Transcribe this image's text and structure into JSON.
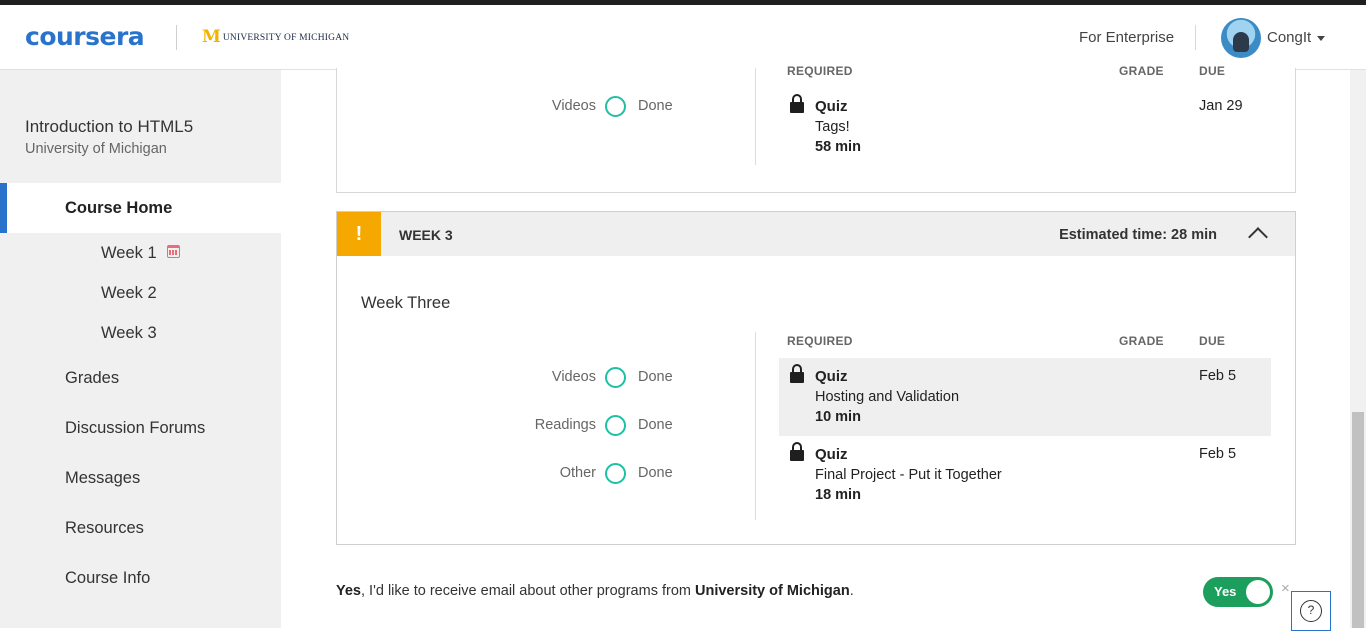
{
  "header": {
    "logo": "coursera",
    "partner": {
      "mark": "M",
      "name": "UNIVERSITY OF MICHIGAN"
    },
    "enterprise_link": "For Enterprise",
    "user_name": "CongIt"
  },
  "sidebar": {
    "course_title": "Introduction to HTML5",
    "course_org": "University of Michigan",
    "items": [
      {
        "label": "Course Home",
        "active": true
      },
      {
        "label": "Week 1",
        "sub": true
      },
      {
        "label": "Week 2",
        "sub": true
      },
      {
        "label": "Week 3",
        "sub": true
      },
      {
        "label": "Grades"
      },
      {
        "label": "Discussion Forums"
      },
      {
        "label": "Messages"
      },
      {
        "label": "Resources"
      },
      {
        "label": "Course Info"
      }
    ]
  },
  "week_prev": {
    "progress": [
      {
        "label": "Videos",
        "status": "Done"
      }
    ],
    "columns": {
      "required": "REQUIRED",
      "grade": "GRADE",
      "due": "DUE"
    },
    "items": [
      {
        "type": "Quiz",
        "name": "Tags!",
        "time": "58 min",
        "due": "Jan 29"
      }
    ]
  },
  "week3": {
    "label": "WEEK 3",
    "warning": "!",
    "estimated": "Estimated time: 28 min",
    "title": "Week Three",
    "progress": [
      {
        "label": "Videos",
        "status": "Done"
      },
      {
        "label": "Readings",
        "status": "Done"
      },
      {
        "label": "Other",
        "status": "Done"
      }
    ],
    "columns": {
      "required": "REQUIRED",
      "grade": "GRADE",
      "due": "DUE"
    },
    "items": [
      {
        "type": "Quiz",
        "name": "Hosting and Validation",
        "time": "10 min",
        "due": "Feb 5"
      },
      {
        "type": "Quiz",
        "name": "Final Project - Put it Together",
        "time": "18 min",
        "due": "Feb 5"
      }
    ]
  },
  "consent": {
    "yes": "Yes",
    "text": ", I'd like to receive email about other programs from ",
    "org": "University of Michigan",
    "end": ".",
    "toggle_label": "Yes",
    "dismiss": "×"
  },
  "help": "?",
  "colors": {
    "brand": "#2a73cc",
    "warning": "#f5a800",
    "progress": "#1fbfa3",
    "toggle": "#1c9e5c"
  }
}
